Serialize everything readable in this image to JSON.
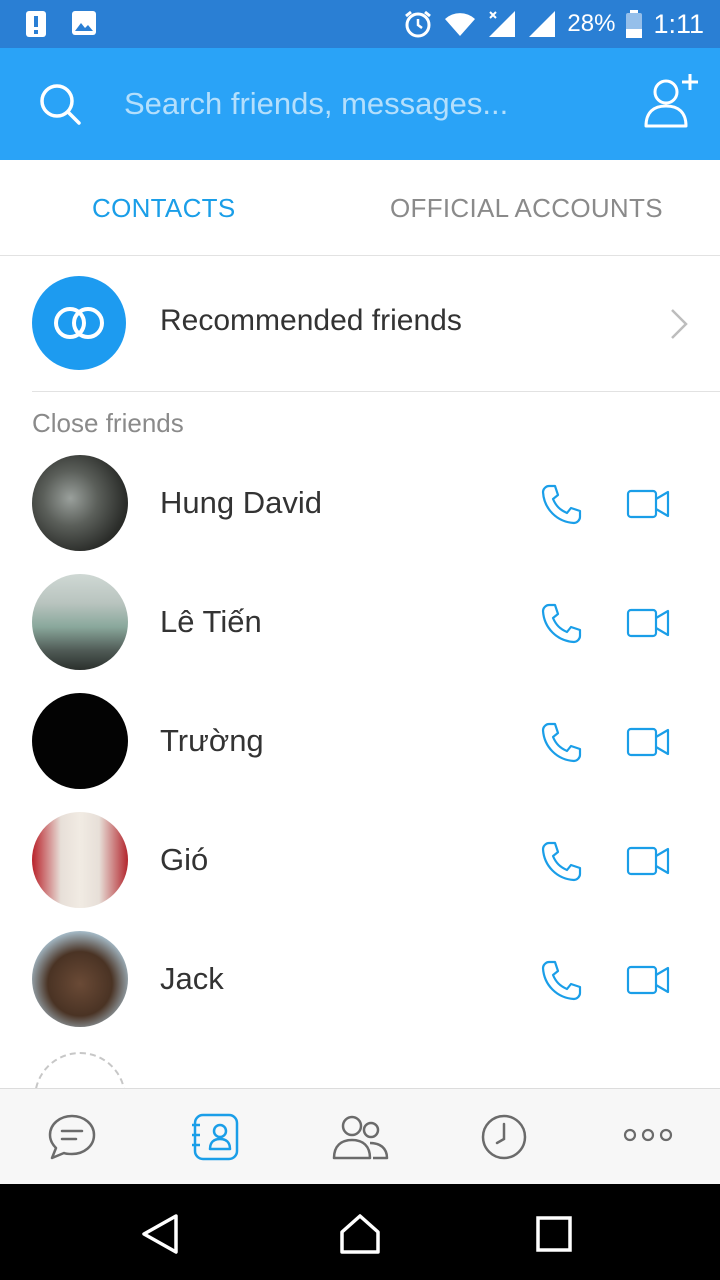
{
  "status_bar": {
    "battery_percent": "28%",
    "time": "1:11"
  },
  "header": {
    "search_placeholder": "Search friends, messages..."
  },
  "tabs": [
    {
      "label": "CONTACTS",
      "active": true
    },
    {
      "label": "OFFICIAL ACCOUNTS",
      "active": false
    }
  ],
  "recommended": {
    "label": "Recommended friends"
  },
  "section": {
    "close_friends": "Close friends"
  },
  "contacts": [
    {
      "name": "Hung David"
    },
    {
      "name": "Lê Tiến"
    },
    {
      "name": "Trường"
    },
    {
      "name": "Gió"
    },
    {
      "name": "Jack"
    }
  ],
  "colors": {
    "accent": "#2aa3f7",
    "status_bar": "#2a7fd4",
    "icon_blue": "#1a9ee8",
    "inactive_text": "#8a8a8a"
  },
  "bottom_nav": [
    {
      "icon": "messages-icon",
      "active": false
    },
    {
      "icon": "contacts-icon",
      "active": true
    },
    {
      "icon": "groups-icon",
      "active": false
    },
    {
      "icon": "timeline-clock-icon",
      "active": false
    },
    {
      "icon": "more-icon",
      "active": false
    }
  ]
}
